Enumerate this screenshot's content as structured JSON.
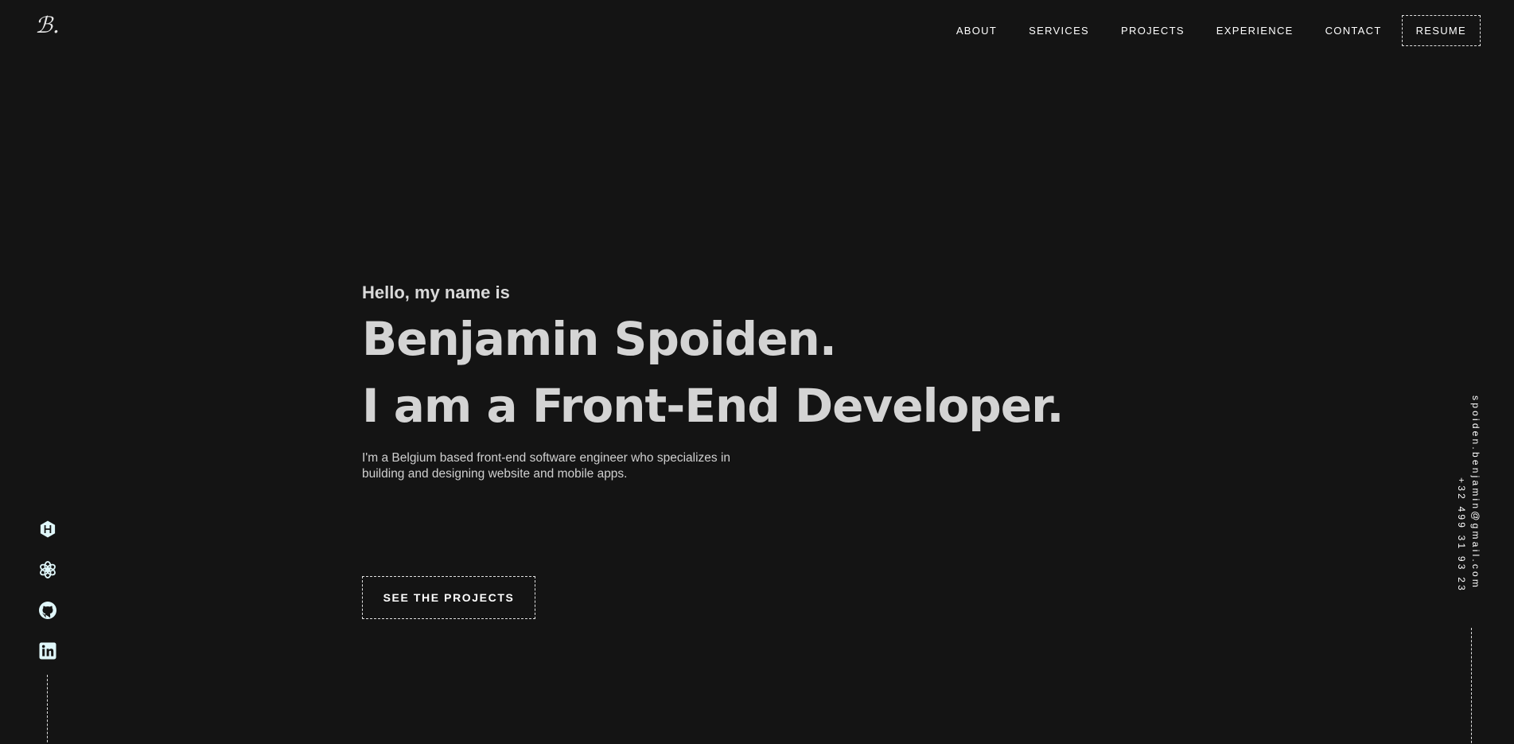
{
  "logo": {
    "text": "ℬ."
  },
  "nav": {
    "items": [
      {
        "label": "ABOUT"
      },
      {
        "label": "SERVICES"
      },
      {
        "label": "PROJECTS"
      },
      {
        "label": "EXPERIENCE"
      },
      {
        "label": "CONTACT"
      }
    ],
    "resume_label": "RESUME"
  },
  "hero": {
    "greeting": "Hello, my name is",
    "name": "Benjamin Spoiden.",
    "role": "I am a Front-End Developer.",
    "description": "I'm a Belgium based front-end software engineer who specializes in building and designing website and mobile apps.",
    "cta_label": "SEE THE PROJECTS"
  },
  "socials": [
    {
      "icon": "hashnode-icon"
    },
    {
      "icon": "openai-icon"
    },
    {
      "icon": "github-icon"
    },
    {
      "icon": "linkedin-icon"
    }
  ],
  "contact": {
    "email": "spoiden.benjamin@gmail.com",
    "phone": "+32 499 31 93 23"
  },
  "colors": {
    "background": "#141414",
    "text": "#ffffff",
    "heading": "#d4d4d4",
    "icon": "#e0f7fa"
  }
}
